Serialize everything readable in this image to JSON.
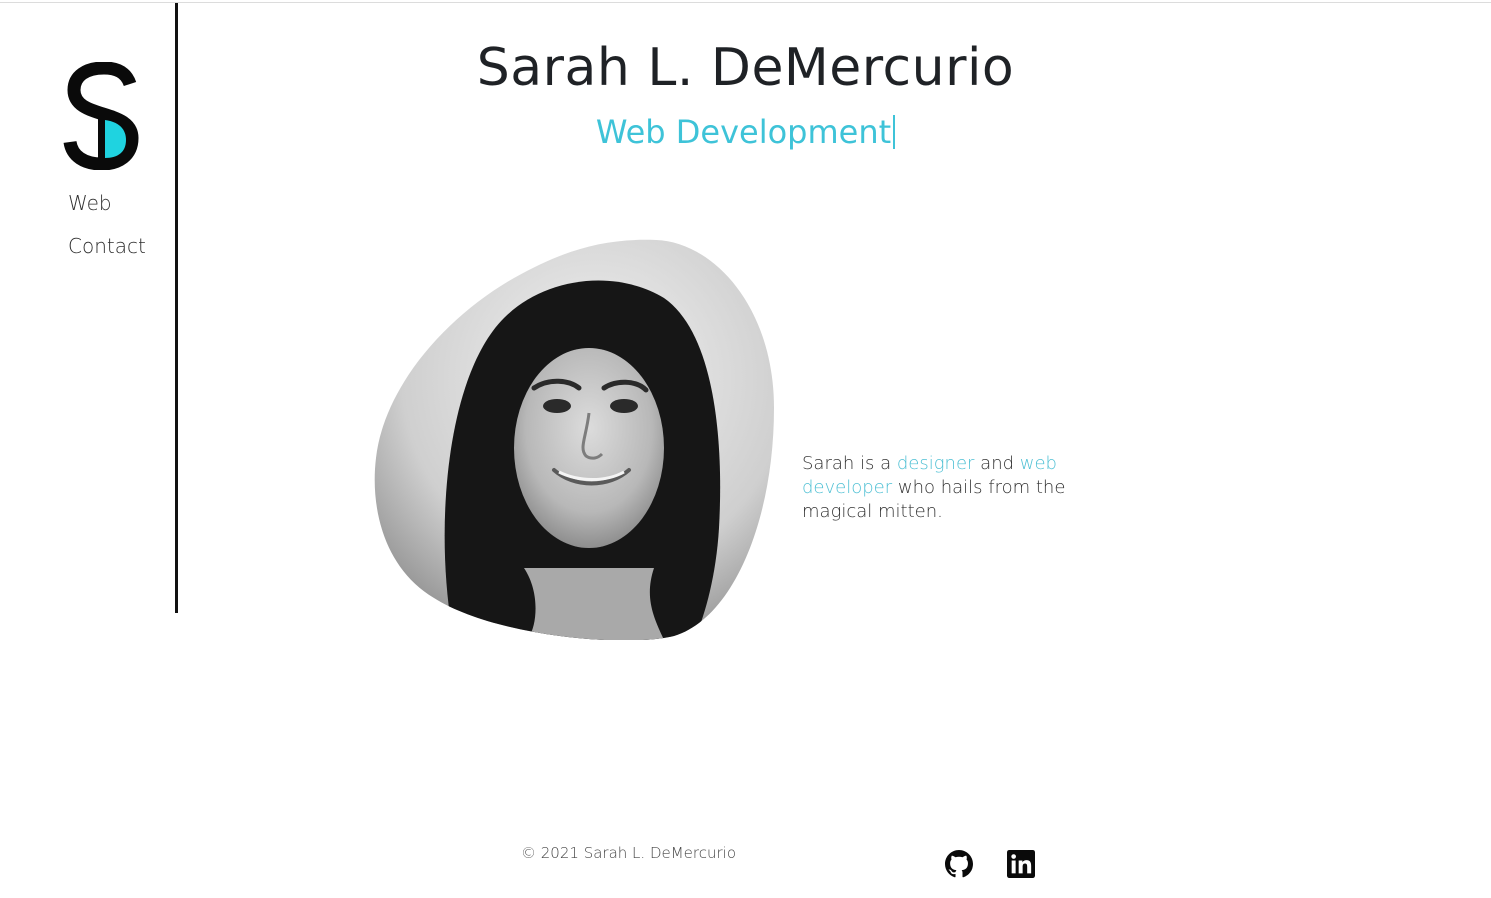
{
  "header": {
    "title": "Sarah L. DeMercurio",
    "subtitle": "Web Development"
  },
  "sidebar": {
    "logo_icon": "sd-monogram-logo",
    "nav": [
      {
        "label": "Web"
      },
      {
        "label": "Contact"
      }
    ]
  },
  "about": {
    "portrait_icon": "portrait-photo",
    "bio": {
      "part1": "Sarah is a ",
      "link1": "designer",
      "part2": " and ",
      "link2": "web developer",
      "part3": " who hails from the magical mitten."
    }
  },
  "footer": {
    "copyright": "© 2021 Sarah L. DeMercurio",
    "social": [
      {
        "icon": "github-icon"
      },
      {
        "icon": "linkedin-icon"
      }
    ]
  },
  "colors": {
    "accent": "#3ec3d8",
    "text": "#1f2226",
    "divider": "#111111"
  }
}
